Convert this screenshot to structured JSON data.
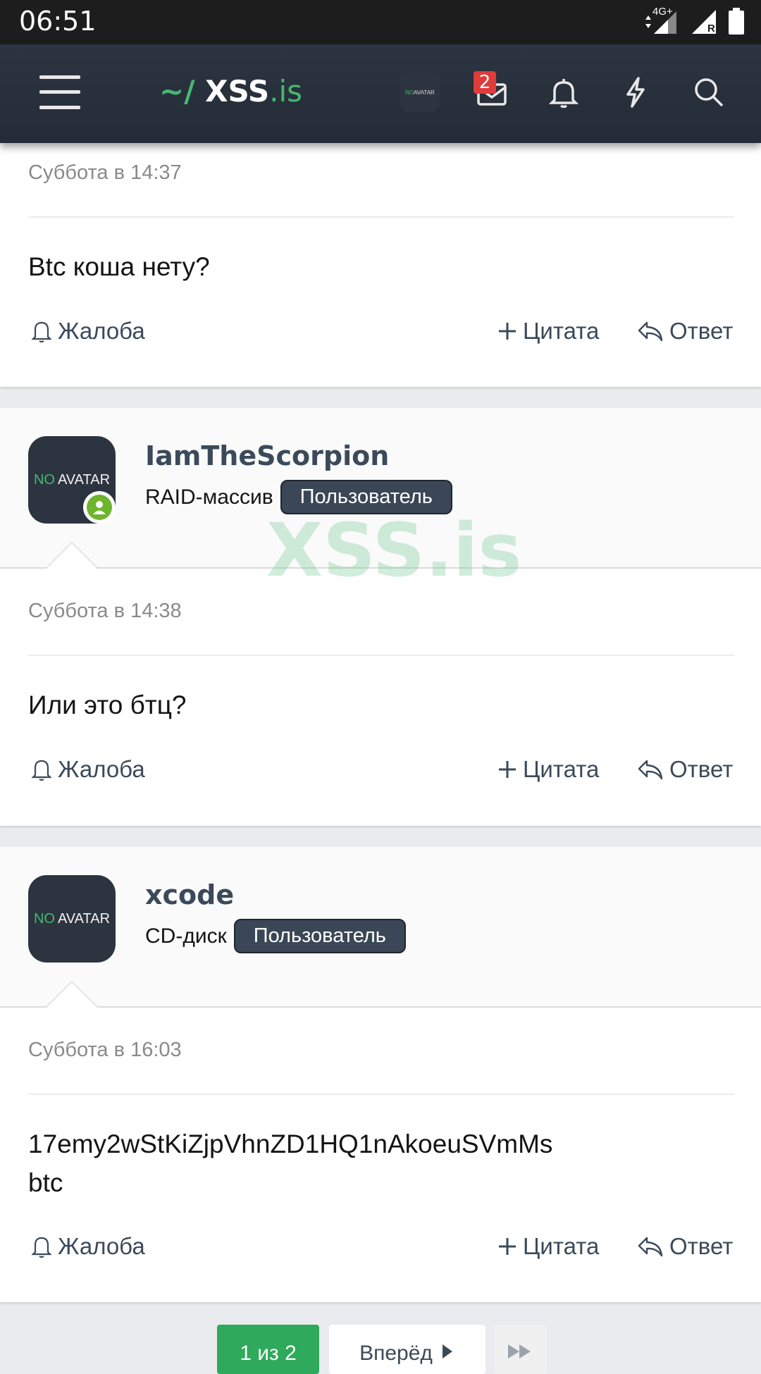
{
  "status_bar": {
    "time": "06:51",
    "network": "4G+",
    "roaming": "R"
  },
  "header": {
    "logo_prefix": "~/",
    "logo_main": "XSS",
    "logo_suffix": ".is",
    "avatar_no": "NO",
    "avatar_text": "AVATAR",
    "inbox_count": "2"
  },
  "watermark": "XSS.is",
  "posts": [
    {
      "date": "Суббота в 14:37",
      "text": "Btc коша нету?",
      "report": "Жалоба",
      "quote": "Цитата",
      "reply": "Ответ"
    },
    {
      "username": "IamTheScorpion",
      "user_title": "RAID-массив",
      "role": "Пользователь",
      "avatar_no": "NO",
      "avatar_text": "AVATAR",
      "date": "Суббота в 14:38",
      "text": "Или это бтц?",
      "report": "Жалоба",
      "quote": "Цитата",
      "reply": "Ответ"
    },
    {
      "username": "xcode",
      "user_title": "CD-диск",
      "role": "Пользователь",
      "avatar_no": "NO",
      "avatar_text": "AVATAR",
      "date": "Суббота в 16:03",
      "text_line1": "17emy2wStKiZjpVhnZD1HQ1nAkoeuSVmMs",
      "text_line2": "btc",
      "report": "Жалоба",
      "quote": "Цитата",
      "reply": "Ответ"
    }
  ],
  "pagination": {
    "current": "1 из 2",
    "next": "Вперёд"
  },
  "colors": {
    "accent_green": "#47b872",
    "header_bg": "#2b3440",
    "badge_red": "#e03b3b",
    "role_bg": "#3b4656",
    "online": "#6cb52c"
  }
}
